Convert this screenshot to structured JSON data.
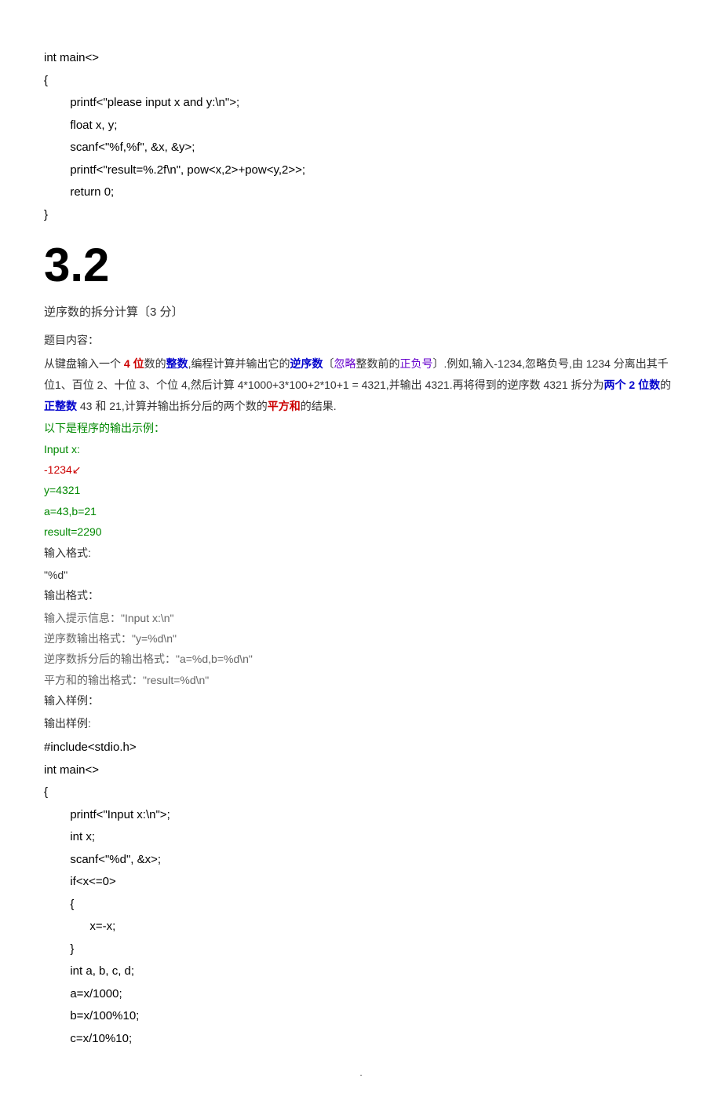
{
  "code1": {
    "l1": "int main<>",
    "l2": "{",
    "l3": "        printf<\"please input x and y:\\n\">;",
    "l4": "        float x, y;",
    "l5": "        scanf<\"%f,%f\", &x, &y>;",
    "l6": "        printf<\"result=%.2f\\n\", pow<x,2>+pow<y,2>>;",
    "l7": "        return 0;",
    "l8": "}"
  },
  "section_num": "3.2",
  "subtitle": "逆序数的拆分计算〔3 分〕",
  "label_content": "题目内容：",
  "desc": {
    "p1_a": "从键盘输入一个 ",
    "p1_b": "4 位",
    "p1_c": "数的",
    "p1_d": "整数",
    "p1_e": ",编程计算并输出它的",
    "p1_f": "逆序数",
    "p1_g": "〔",
    "p1_h": "忽略",
    "p1_i": "整数前的",
    "p1_j": "正负号",
    "p1_k": "〕.例如,输入-1234,忽略负号,由 1234 分离出其千位",
    "p2": "1、百位 2、十位 3、个位 4,然后计算 4*1000+3*100+2*10+1 = 4321,并输出 4321.再将得到的逆序数 4321 拆分为",
    "p2_b": "两个 2 位数",
    "p2_c": "的",
    "p2_d": "正整",
    "p3_a": "数",
    "p3_b": " 43 和 21,计算并输出拆分后的两个数的",
    "p3_c": "平方和",
    "p3_d": "的结果."
  },
  "example_label": "以下是程序的输出示例：",
  "ex": {
    "l1": "Input x:",
    "l2": "-1234↙",
    "l3": "y=4321",
    "l4": "a=43,b=21",
    "l5": "result=2290"
  },
  "input_format_label": "输入格式:",
  "input_format_val": "\"%d\"",
  "output_format_label": "输出格式：",
  "fmt": {
    "l1": "输入提示信息：\"Input x:\\n\"",
    "l2": "逆序数输出格式：\"y=%d\\n\"",
    "l3": "逆序数拆分后的输出格式：\"a=%d,b=%d\\n\"",
    "l4": "平方和的输出格式：\"result=%d\\n\""
  },
  "input_sample_label": "输入样例：",
  "output_sample_label": "输出样例:",
  "code2": {
    "l1": "#include<stdio.h>",
    "l2": "int main<>",
    "l3": "{",
    "l4": "        printf<\"Input x:\\n\">;",
    "l5": "        int x;",
    "l6": "        scanf<\"%d\", &x>;",
    "l7": "        if<x<=0>",
    "l8": "        {",
    "l9": "              x=-x;",
    "l10": "        }",
    "l11": "        int a, b, c, d;",
    "l12": "        a=x/1000;",
    "l13": "        b=x/100%10;",
    "l14": "        c=x/10%10;"
  },
  "footer": "."
}
